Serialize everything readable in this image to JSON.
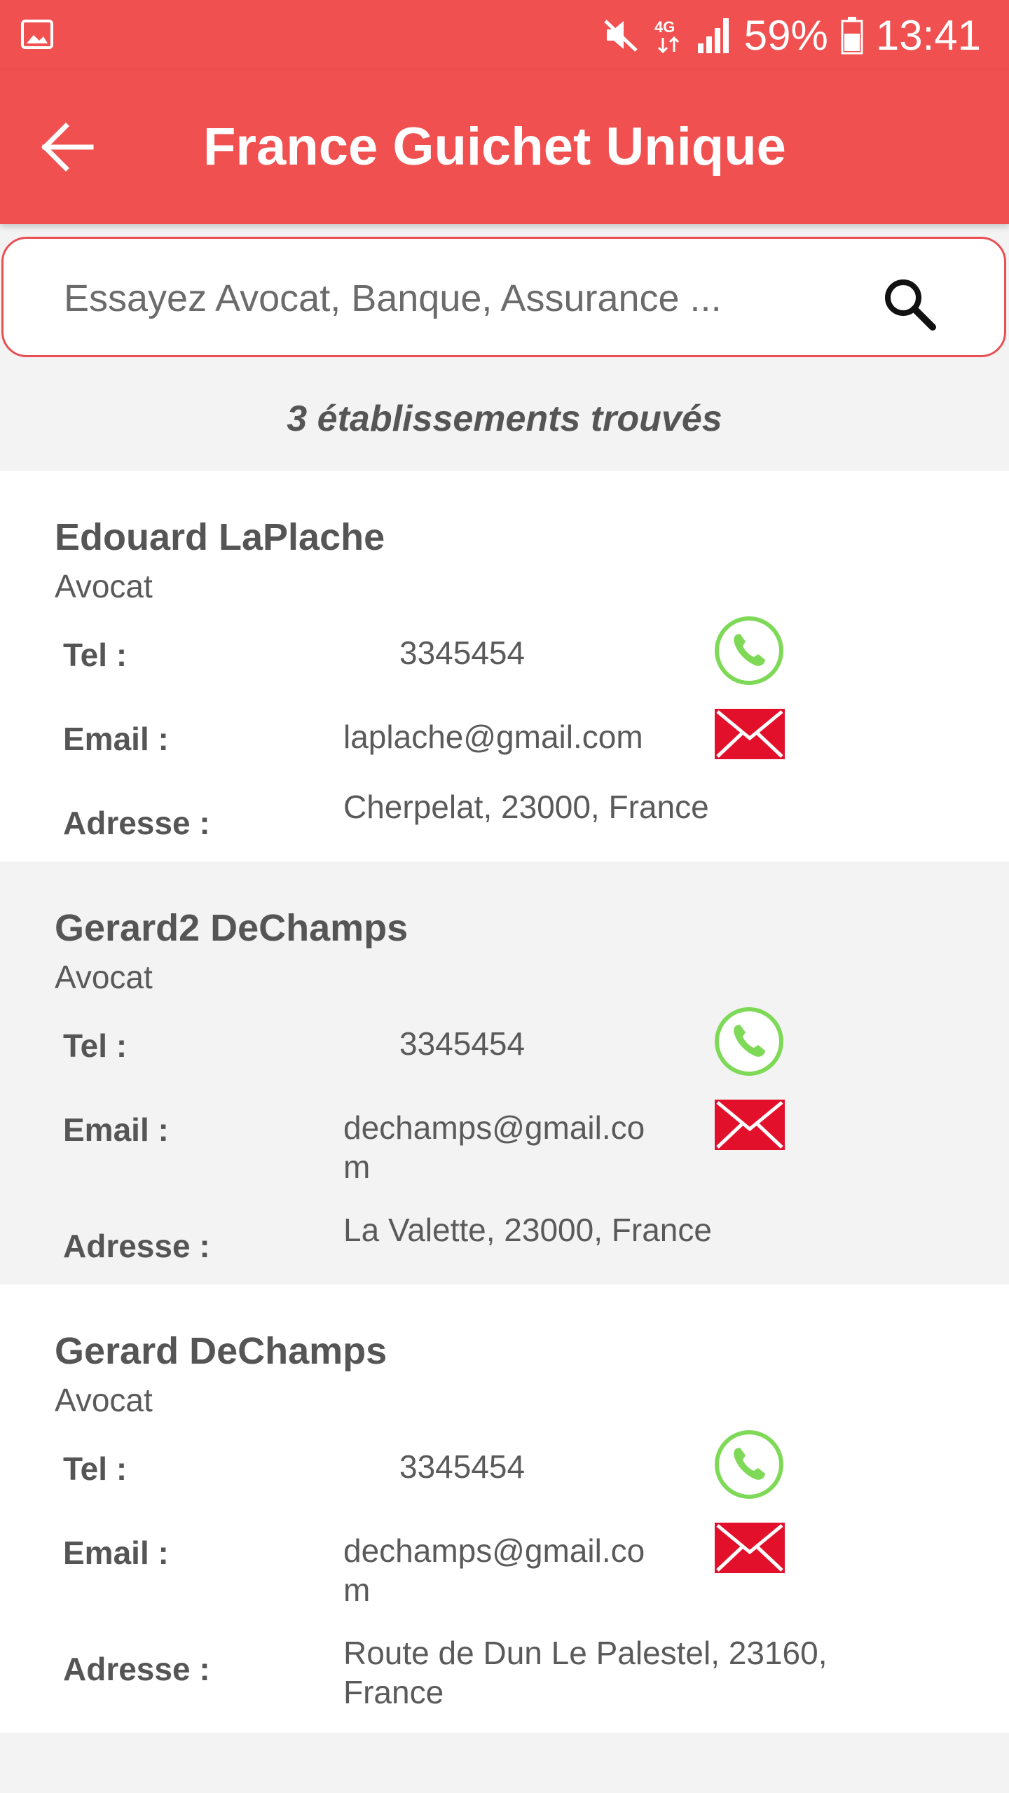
{
  "status_bar": {
    "battery_percent": "59%",
    "time": "13:41",
    "network": "4G"
  },
  "app_bar": {
    "title": "France Guichet Unique"
  },
  "search": {
    "placeholder": "Essayez Avocat, Banque, Assurance ..."
  },
  "results": {
    "count_text": "3 établissements trouvés"
  },
  "labels": {
    "tel": "Tel :",
    "email": "Email :",
    "address": "Adresse :"
  },
  "establishments": [
    {
      "name": "Edouard LaPlache",
      "category": "Avocat",
      "tel": "3345454",
      "email_line1": "laplache@gmail.com",
      "email_line2": "",
      "address_line1": "Cherpelat, 23000, France",
      "address_line2": ""
    },
    {
      "name": "Gerard2 DeChamps",
      "category": "Avocat",
      "tel": "3345454",
      "email_line1": "dechamps@gmail.co",
      "email_line2": "m",
      "address_line1": "La Valette, 23000, France",
      "address_line2": ""
    },
    {
      "name": "Gerard DeChamps",
      "category": "Avocat",
      "tel": "3345454",
      "email_line1": "dechamps@gmail.co",
      "email_line2": "m",
      "address_line1": "Route de Dun Le Palestel, 23160,",
      "address_line2": "France"
    }
  ],
  "colors": {
    "accent": "#f05050",
    "phone_green": "#7ed957",
    "mail_red": "#e2102a"
  }
}
